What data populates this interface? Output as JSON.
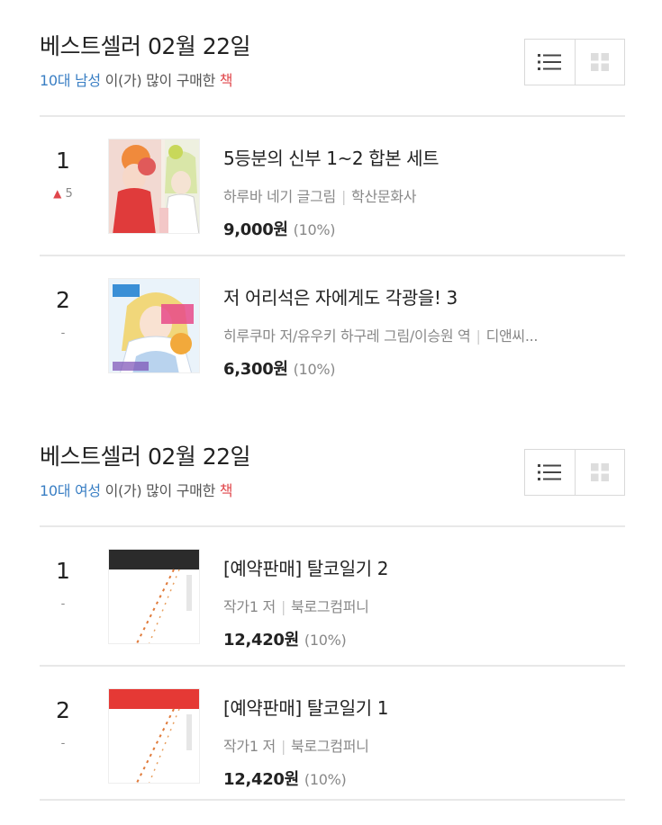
{
  "sections": [
    {
      "title": "베스트셀러 02월 22일",
      "sub_segment": "10대 남성",
      "sub_middle": " 이(가) 많이 구매한 ",
      "sub_end": "책",
      "items": [
        {
          "rank": "1",
          "change_arrow": "▲",
          "change": "5",
          "title": "5등분의 신부 1~2 합본 세트",
          "author": "하루바 네기 글그림",
          "publisher": "학산문화사",
          "price": "9,000원",
          "discount": "(10%)"
        },
        {
          "rank": "2",
          "change_arrow": "",
          "change": "-",
          "title": "저 어리석은 자에게도 각광을! 3",
          "author": "히루쿠마 저/유우키 하구레 그림/이승원 역",
          "publisher": "디앤씨...",
          "price": "6,300원",
          "discount": "(10%)"
        }
      ]
    },
    {
      "title": "베스트셀러 02월 22일",
      "sub_segment": "10대 여성",
      "sub_middle": " 이(가) 많이 구매한 ",
      "sub_end": "책",
      "items": [
        {
          "rank": "1",
          "change_arrow": "",
          "change": "-",
          "title": "[예약판매] 탈코일기 2",
          "author": "작가1 저",
          "publisher": "북로그컴퍼니",
          "price": "12,420원",
          "discount": "(10%)"
        },
        {
          "rank": "2",
          "change_arrow": "",
          "change": "-",
          "title": "[예약판매] 탈코일기 1",
          "author": "작가1 저",
          "publisher": "북로그컴퍼니",
          "price": "12,420원",
          "discount": "(10%)"
        }
      ]
    }
  ],
  "icons": {
    "list_view": "list-view-icon",
    "grid_view": "grid-view-icon"
  },
  "colors": {
    "segment_blue": "#3a7fc4",
    "accent_red": "#e0464b",
    "cover_band_black": "#2b2b2b",
    "cover_band_red": "#e53935"
  }
}
